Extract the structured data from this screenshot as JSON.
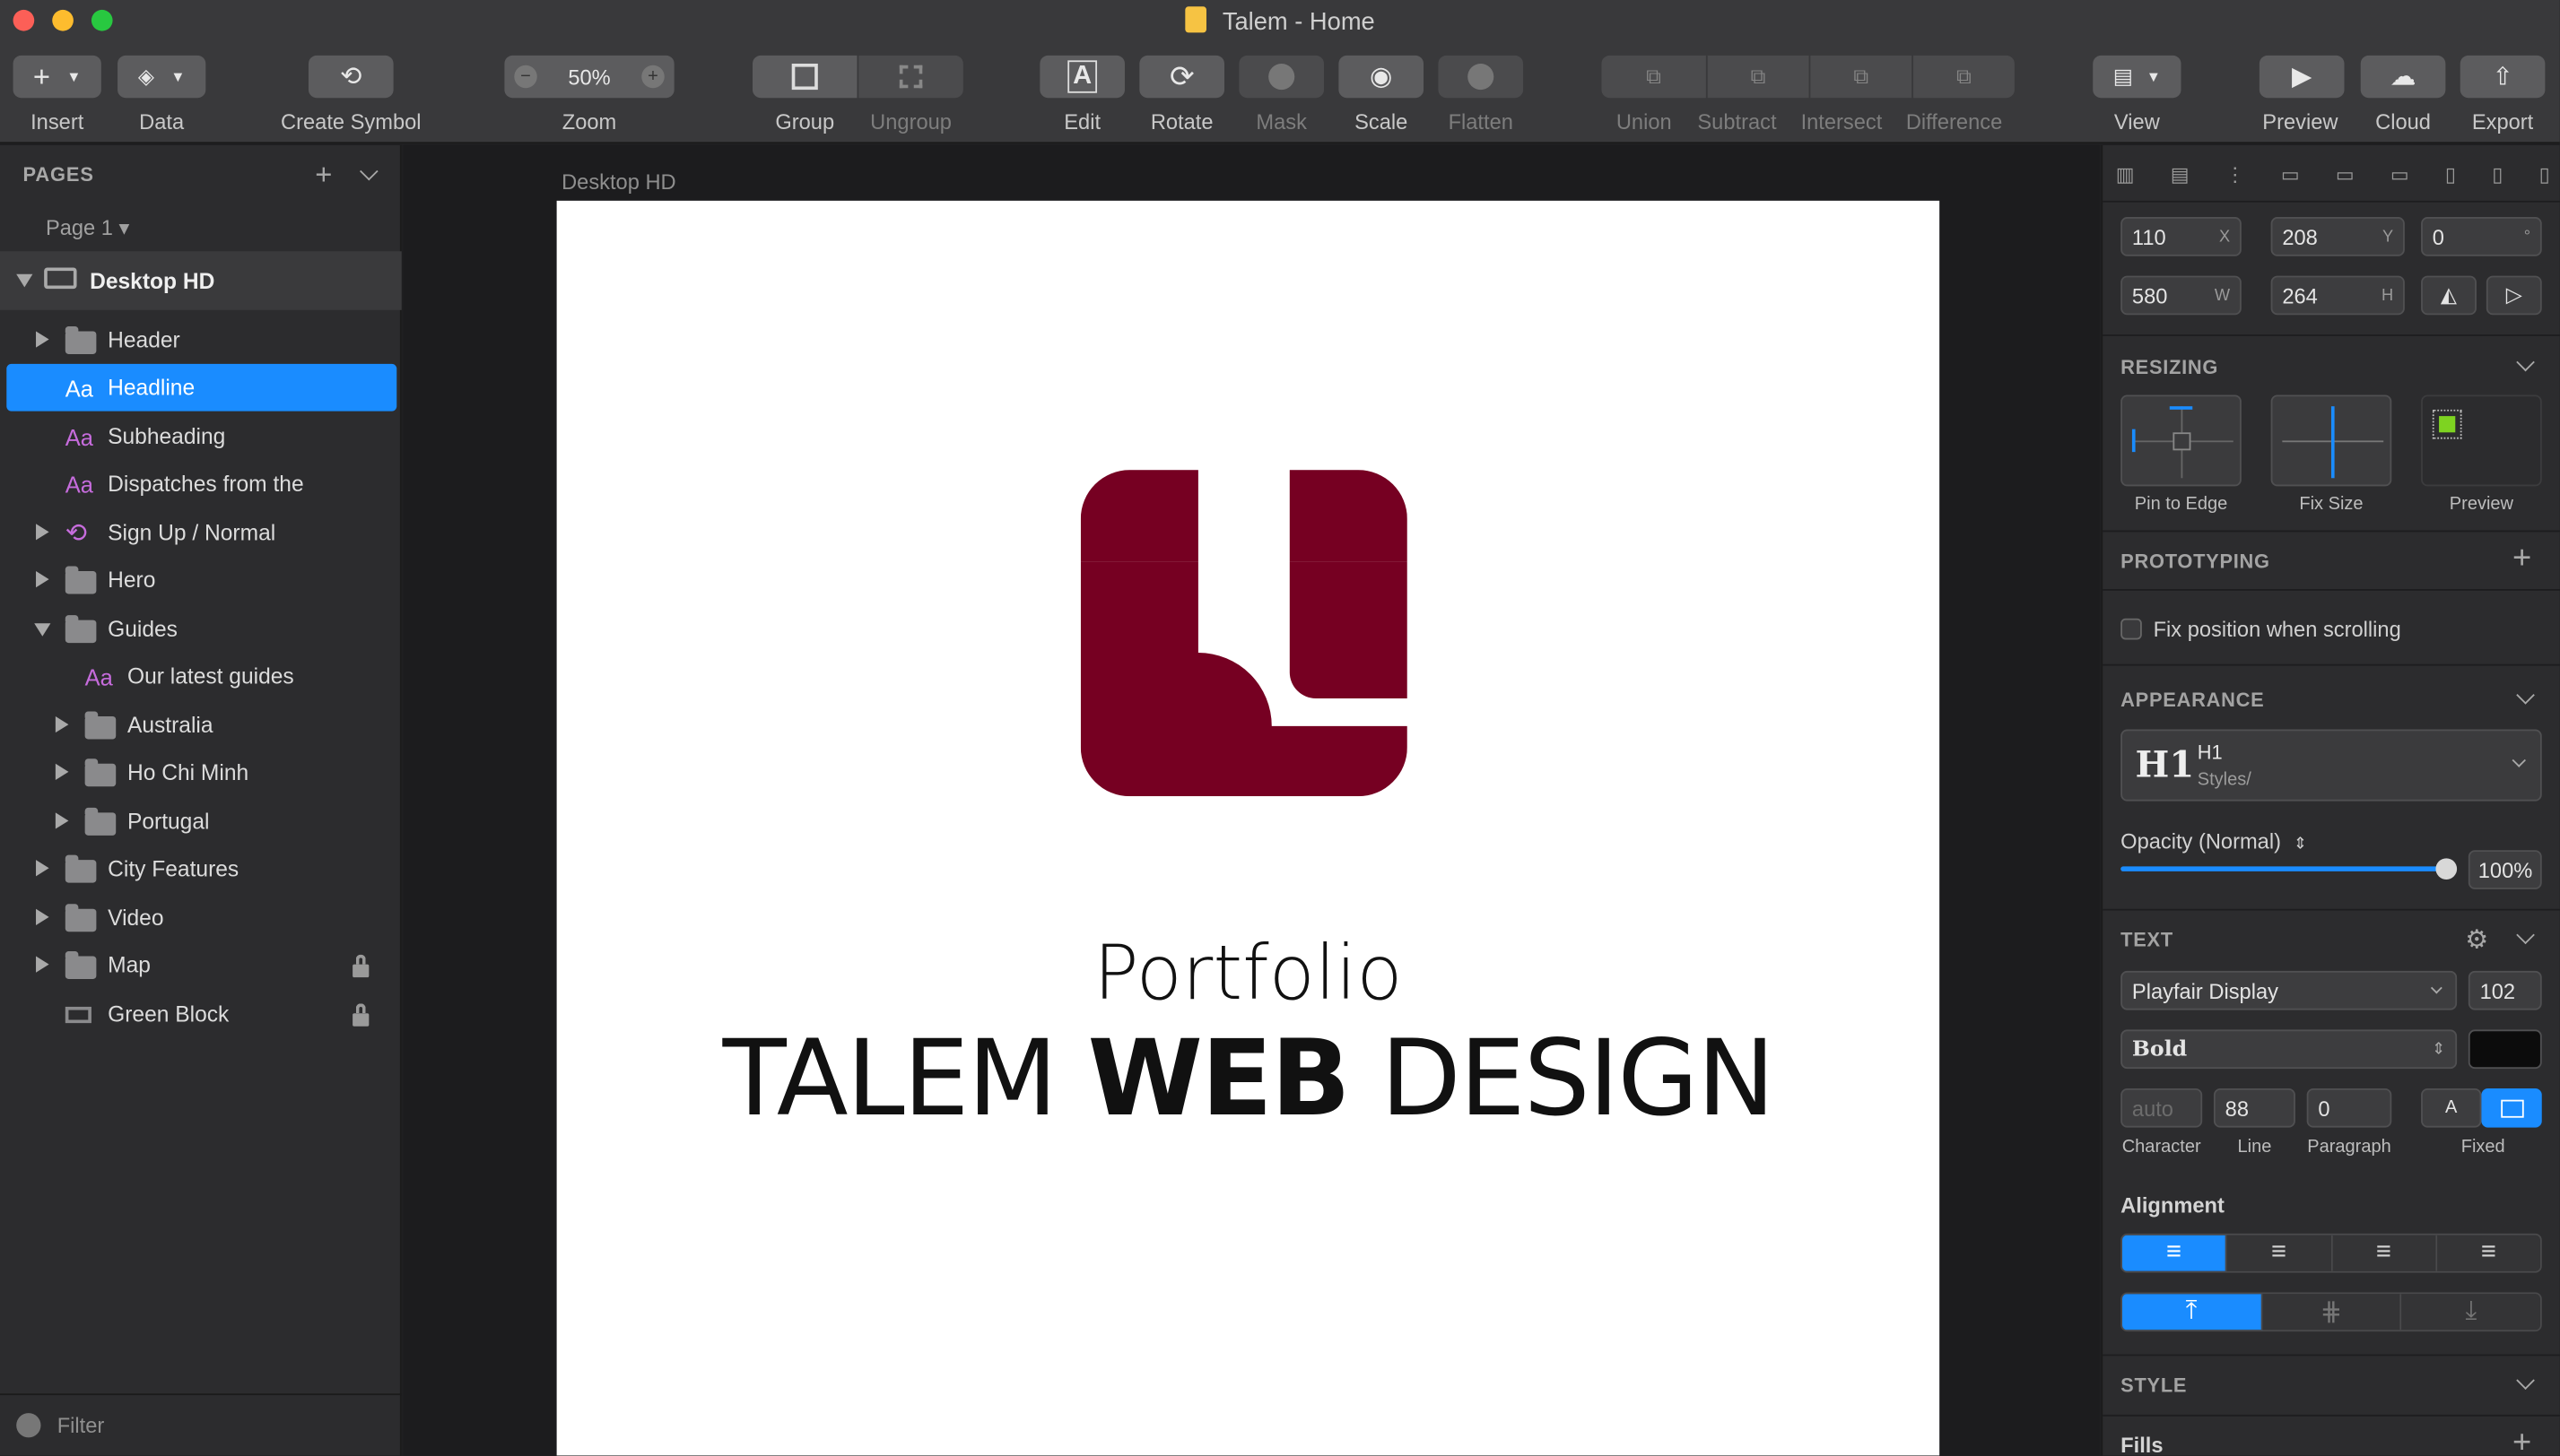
{
  "window": {
    "title": "Talem - Home"
  },
  "toolbar": {
    "insert": "Insert",
    "data": "Data",
    "create_symbol": "Create Symbol",
    "zoom": "Zoom",
    "zoom_value": "50%",
    "group": "Group",
    "ungroup": "Ungroup",
    "edit": "Edit",
    "rotate": "Rotate",
    "mask": "Mask",
    "scale": "Scale",
    "flatten": "Flatten",
    "union": "Union",
    "subtract": "Subtract",
    "intersect": "Intersect",
    "difference": "Difference",
    "view": "View",
    "preview": "Preview",
    "cloud": "Cloud",
    "export": "Export"
  },
  "pages": {
    "header": "PAGES",
    "current": "Page 1"
  },
  "layers": {
    "artboard": "Desktop HD",
    "items": [
      "Header",
      "Headline",
      "Subheading",
      "Dispatches from the",
      "Sign Up / Normal",
      "Hero",
      "Guides",
      "Our latest guides",
      "Australia",
      "Ho Chi Minh",
      "Portugal",
      "City Features",
      "Video",
      "Map",
      "Green Block"
    ]
  },
  "filter": {
    "placeholder": "Filter"
  },
  "canvas": {
    "artboard_label": "Desktop HD",
    "logo_color": "#760022",
    "subtitle": "Portfolio",
    "headline_a": "TALEM ",
    "headline_b": "WEB",
    "headline_c": " DESIGN"
  },
  "inspector": {
    "x": "110",
    "x_suf": "X",
    "y": "208",
    "y_suf": "Y",
    "rot": "0",
    "rot_suf": "°",
    "w": "580",
    "w_suf": "W",
    "h": "264",
    "h_suf": "H",
    "resizing": "RESIZING",
    "pin": "Pin to Edge",
    "fix": "Fix Size",
    "preview": "Preview",
    "prototyping": "PROTOTYPING",
    "fixpos": "Fix position when scrolling",
    "appearance": "APPEARANCE",
    "style_icon": "H1",
    "style_name": "H1",
    "style_path": "Styles/",
    "opacity": "Opacity (Normal)",
    "opacity_value": "100%",
    "opacity_fraction": 1.0,
    "text": "TEXT",
    "font": "Playfair Display",
    "size": "102",
    "weight": "Bold",
    "character": "auto",
    "line": "88",
    "paragraph": "0",
    "character_l": "Character",
    "line_l": "Line",
    "paragraph_l": "Paragraph",
    "fixed_l": "Fixed",
    "alignment": "Alignment",
    "style": "STYLE",
    "fills": "Fills"
  },
  "colors": {
    "accent": "#1a8cff",
    "logo": "#760022"
  }
}
